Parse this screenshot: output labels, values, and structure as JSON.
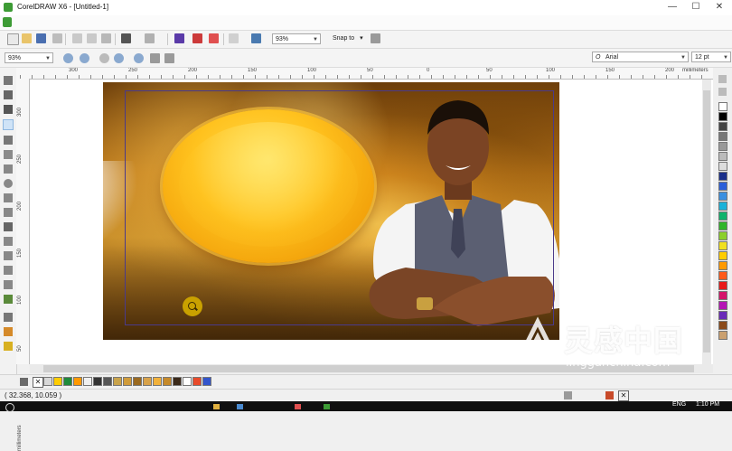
{
  "window": {
    "title": "CorelDRAW X6 - [Untitled-1]",
    "minimize_glyph": "—",
    "maximize_glyph": "☐",
    "close_glyph": "✕"
  },
  "toolbar": {
    "zoom_level": "93%",
    "snap_to_label": "Snap to",
    "snap_arrow": "▾"
  },
  "property_bar": {
    "zoom_level": "93%",
    "font_icon_glyph": "O",
    "font_name": "Arial",
    "font_size": "12 pt"
  },
  "ruler": {
    "top_labels": [
      "300",
      "250",
      "200",
      "150",
      "100",
      "50",
      "0",
      "50",
      "100",
      "150",
      "200"
    ],
    "unit_label": "millimeters",
    "left_labels": [
      "300",
      "250",
      "200",
      "150",
      "100",
      "50"
    ],
    "left_unit_label": "millimeters"
  },
  "status": {
    "coordinates": "( 32.368, 10.059 )"
  },
  "taskbar": {
    "language": "ENG",
    "time": "1:10 PM"
  },
  "watermark": {
    "logo_text": "灵感中国",
    "url_text": "lingganchina.com"
  },
  "colors": {
    "accent_green": "#3d9b35",
    "frame_border": "#4a3a8a",
    "palette_bottom": [
      "#d8d8d8",
      "#ffcc00",
      "#1f8a3b",
      "#ff9900",
      "#f0f0f0",
      "#333333",
      "#555555",
      "#c9a34a",
      "#d09b3a",
      "#9b6a20",
      "#d8a24a",
      "#f2b13a",
      "#c68a2a",
      "#3b2a1a",
      "#ffffff",
      "#e84a2a",
      "#3355cc"
    ],
    "palette_right": [
      "#ffffff",
      "#000000",
      "#444444",
      "#777777",
      "#999999",
      "#bbbbbb",
      "#dddddd",
      "#1a2f8a",
      "#2b5fd9",
      "#3a8fe0",
      "#1bb2d9",
      "#0fb36b",
      "#2fb52a",
      "#8ccf2a",
      "#f0e020",
      "#ffcc00",
      "#ff9a00",
      "#ff5a1a",
      "#e81a1a",
      "#d4146a",
      "#b414b4",
      "#6a2ab8",
      "#8a4a1a",
      "#caa070"
    ]
  }
}
